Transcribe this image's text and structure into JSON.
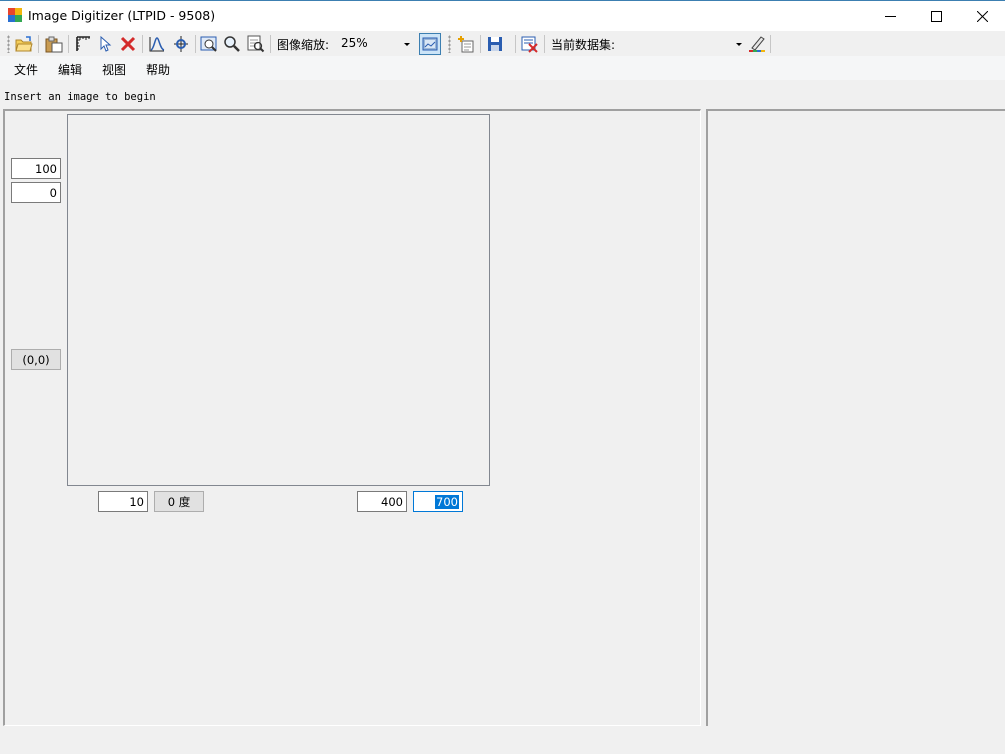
{
  "window": {
    "title": "Image Digitizer (LTPID - 9508)",
    "controls": [
      "minimize",
      "maximize",
      "close"
    ]
  },
  "toolbar": {
    "buttons": [
      "open-folder-icon",
      "paste-icon",
      "axis-ruler-icon",
      "pointer-icon",
      "delete-x-icon",
      "curve-icon",
      "point-marker-icon",
      "zoom-window-icon",
      "magnifier-icon",
      "zoom-region-icon",
      "fit-image-icon",
      "add-dataset-icon",
      "save-icon",
      "remove-dataset-icon",
      "pen-color-icon"
    ],
    "zoom_label": "图像缩放:",
    "zoom_value": "25%",
    "dataset_label": "当前数据集:",
    "dataset_value": ""
  },
  "menu": [
    "文件",
    "编辑",
    "视图",
    "帮助"
  ],
  "hint": "Insert an image to begin",
  "axes": {
    "y_max": "100",
    "y_min": "0",
    "origin": "(0,0)",
    "x_min": "10",
    "angle": "0 度",
    "x_max": "400",
    "x_max_selected": "700"
  },
  "colors": {
    "accent": "#0078d7",
    "close_x": "#d42b2b"
  }
}
